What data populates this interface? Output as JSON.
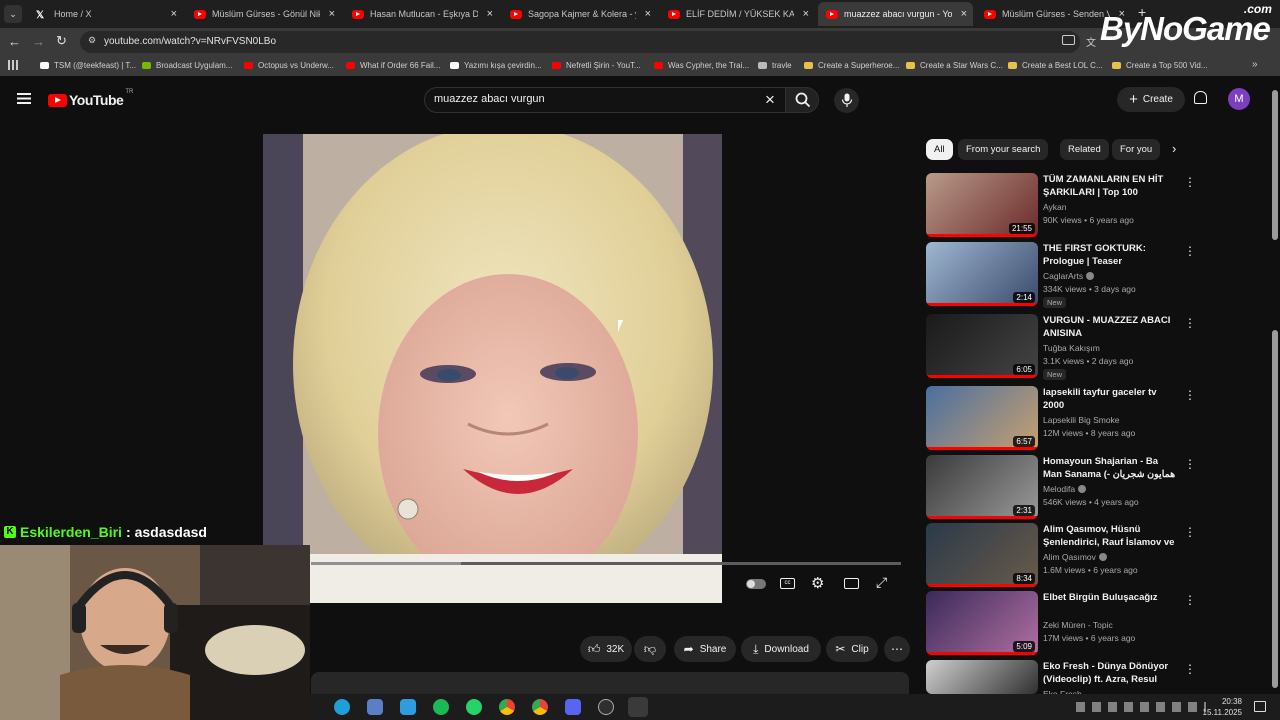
{
  "browser": {
    "tabs": [
      {
        "title": "Home / X",
        "icon": "x-logo-icon",
        "active": false
      },
      {
        "title": "Müslüm Gürses - Gönül Nikahı",
        "icon": "youtube-icon",
        "active": false
      },
      {
        "title": "Hasan Mutlucan - Eşkıya Dünya",
        "icon": "youtube-icon",
        "active": false
      },
      {
        "title": "Sagopa Kajmer & Kolera - yarın",
        "icon": "youtube-icon",
        "active": false
      },
      {
        "title": "ELİF DEDİM / YÜKSEK KALİTE S",
        "icon": "youtube-icon",
        "active": false
      },
      {
        "title": "muazzez abacı vurgun - Yo",
        "icon": "youtube-icon",
        "active": true
      },
      {
        "title": "Müslüm Gürses - Senden Vazg",
        "icon": "youtube-icon",
        "active": false
      }
    ],
    "url": "youtube.com/watch?v=NRvFVSN0LBo",
    "bookmarks": [
      {
        "label": "TSM (@teekfeast) | T...",
        "color": "#ffffff"
      },
      {
        "label": "Broadcast Uygulam...",
        "color": "#76b900"
      },
      {
        "label": "Octopus vs Underw...",
        "color": "#ff0000"
      },
      {
        "label": "What if Order 66 Fail...",
        "color": "#ff0000"
      },
      {
        "label": "Yazımı kışa çevirdin...",
        "color": "#ffffff"
      },
      {
        "label": "Nefretli Şirin - YouT...",
        "color": "#ff0000"
      },
      {
        "label": "Was Cypher, the Trai...",
        "color": "#ff0000"
      },
      {
        "label": "travle",
        "color": "#bbbbbb"
      },
      {
        "label": "Create a Superheroe...",
        "color": "#e8c14a"
      },
      {
        "label": "Create a Star Wars C...",
        "color": "#e8c14a"
      },
      {
        "label": "Create a Best LOL C...",
        "color": "#e8c14a"
      },
      {
        "label": "Create a Top 500 Vid...",
        "color": "#e8c14a"
      }
    ]
  },
  "youtube": {
    "logo": "YouTube",
    "logo_country": "TR",
    "search_value": "muazzez abacı vurgun",
    "create_label": "Create",
    "avatar_letter": "M",
    "actions": {
      "likes": "32K",
      "share": "Share",
      "download": "Download",
      "clip": "Clip"
    },
    "chips": [
      "All",
      "From your search",
      "Related",
      "For you"
    ],
    "recommendations": [
      {
        "title": "TÜM ZAMANLARIN EN HİT ŞARKILARI | Top 100",
        "channel": "Aykan",
        "verified": false,
        "meta": "90K views • 6 years ago",
        "duration": "21:55",
        "badge": ""
      },
      {
        "title": "THE FIRST GOKTURK: Prologue | Teaser",
        "channel": "CaglarArts",
        "verified": true,
        "meta": "334K views • 3 days ago",
        "duration": "2:14",
        "badge": "New"
      },
      {
        "title": "VURGUN - MUAZZEZ ABACI ANISINA",
        "channel": "Tuğba Kakışım",
        "verified": false,
        "meta": "3.1K views • 2 days ago",
        "duration": "6:05",
        "badge": "New"
      },
      {
        "title": "lapsekili tayfur gaceler tv 2000",
        "channel": "Lapsekili Big Smoke",
        "verified": false,
        "meta": "12M views • 8 years ago",
        "duration": "6:57",
        "badge": ""
      },
      {
        "title": "Homayoun Shajarian - Ba Man Sanama (- همایون شجریان - با من صنما",
        "channel": "Melodifa",
        "verified": true,
        "meta": "546K views • 4 years ago",
        "duration": "2:31",
        "badge": ""
      },
      {
        "title": "Alim Qasımov, Hüsnü Şenlendirici, Rauf İslamov ve ...",
        "channel": "Alim Qasımov",
        "verified": true,
        "meta": "1.6M views • 6 years ago",
        "duration": "8:34",
        "badge": ""
      },
      {
        "title": "Elbet Birgün Buluşacağız",
        "channel": "Zeki Müren - Topic",
        "verified": false,
        "meta": "17M views • 6 years ago",
        "duration": "5:09",
        "badge": ""
      },
      {
        "title": "Eko Fresh - Dünya Dönüyor (Videoclip) ft. Azra, Resul Barini",
        "channel": "Eko Fresh",
        "verified": false,
        "meta": "",
        "duration": "",
        "badge": ""
      }
    ]
  },
  "stream": {
    "chat_user": "Eskilerden_Biri",
    "chat_separator": ":",
    "chat_message": "asdasdasd",
    "watermark": "ByNoGame",
    "watermark_suffix": ".com"
  },
  "taskbar": {
    "time": "20:38",
    "date": "15.11.2025"
  }
}
